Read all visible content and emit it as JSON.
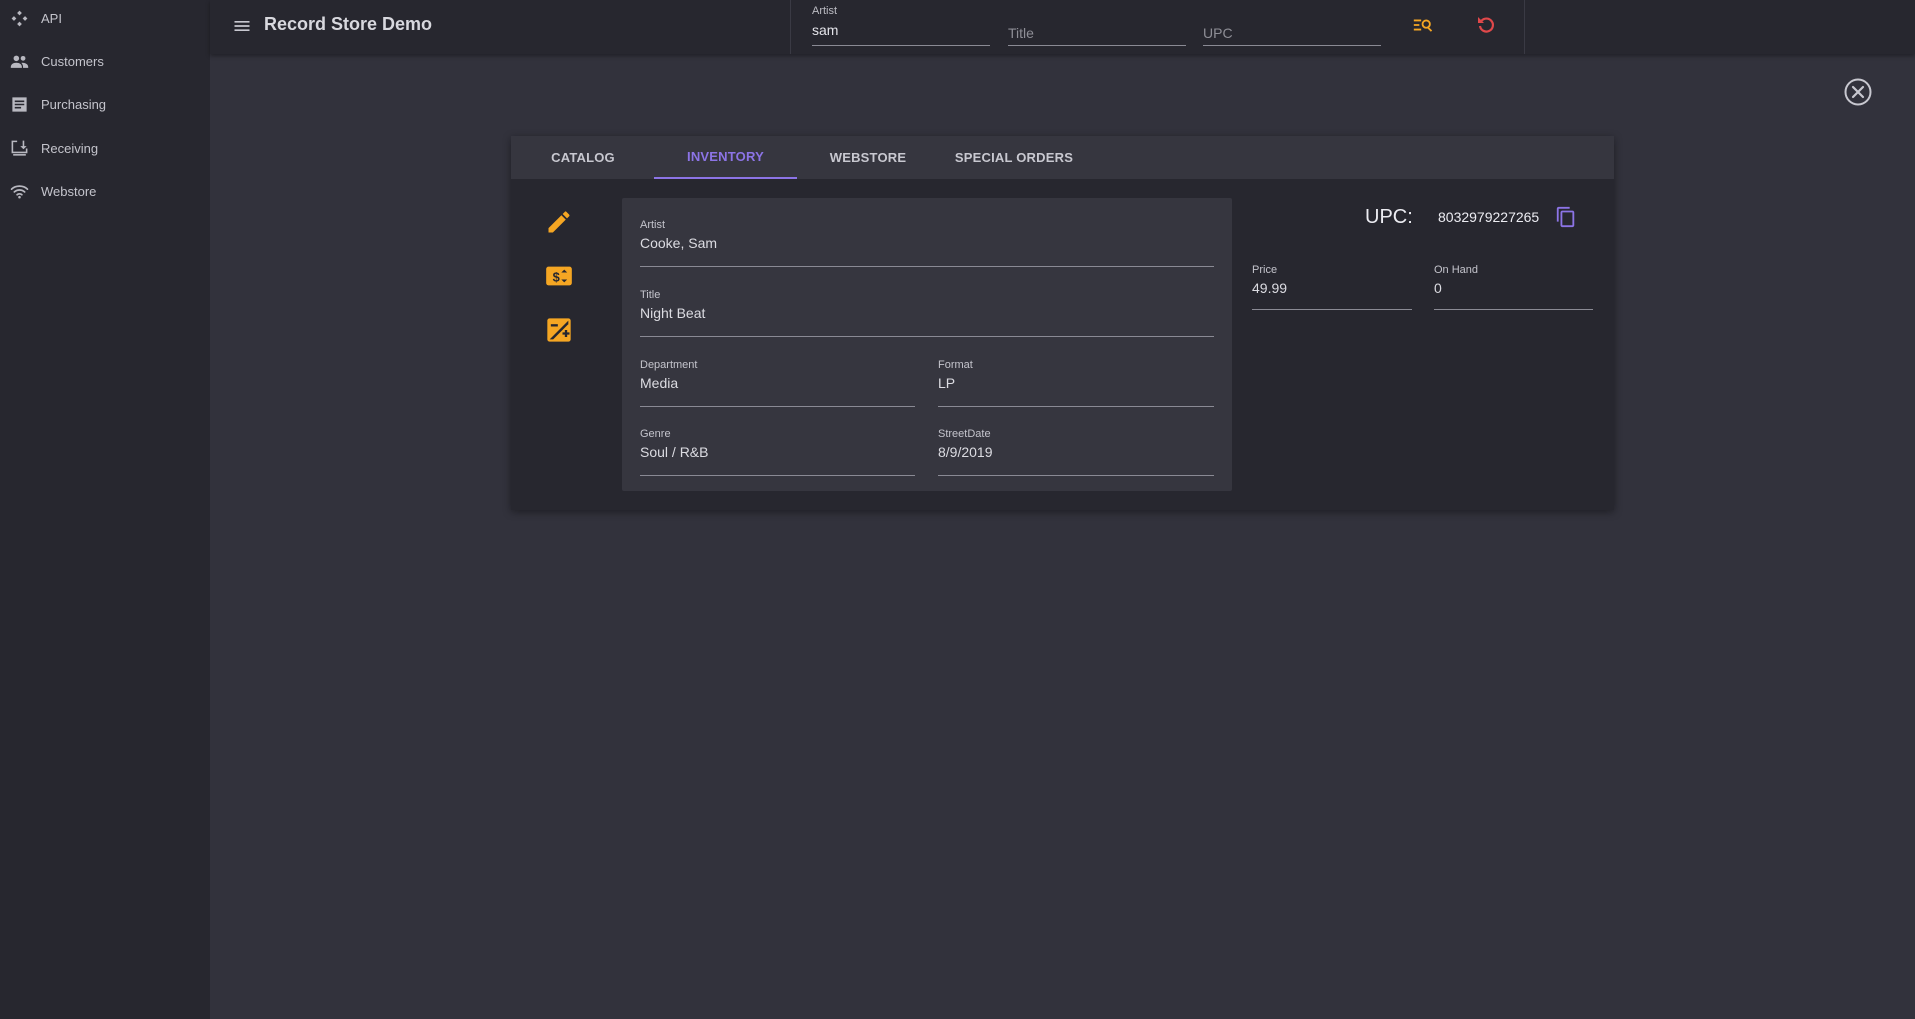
{
  "sidebar": {
    "items": [
      {
        "label": "API",
        "icon": "api-icon"
      },
      {
        "label": "Customers",
        "icon": "customers-icon"
      },
      {
        "label": "Purchasing",
        "icon": "purchasing-icon"
      },
      {
        "label": "Receiving",
        "icon": "receiving-icon"
      },
      {
        "label": "Webstore",
        "icon": "wifi-icon"
      }
    ]
  },
  "header": {
    "title": "Record Store Demo",
    "search": {
      "artist_label": "Artist",
      "artist_value": "sam",
      "title_placeholder": "Title",
      "upc_placeholder": "UPC"
    }
  },
  "tabs": [
    {
      "label": "CATALOG",
      "active": false
    },
    {
      "label": "INVENTORY",
      "active": true
    },
    {
      "label": "WEBSTORE",
      "active": false
    },
    {
      "label": "SPECIAL ORDERS",
      "active": false
    }
  ],
  "form": {
    "artist": {
      "label": "Artist",
      "value": "Cooke, Sam"
    },
    "title": {
      "label": "Title",
      "value": "Night Beat"
    },
    "department": {
      "label": "Department",
      "value": "Media"
    },
    "format": {
      "label": "Format",
      "value": "LP"
    },
    "genre": {
      "label": "Genre",
      "value": "Soul / R&B"
    },
    "street_date": {
      "label": "StreetDate",
      "value": "8/9/2019"
    }
  },
  "inventory": {
    "upc_label": "UPC:",
    "upc_value": "8032979227265",
    "price": {
      "label": "Price",
      "value": "49.99"
    },
    "on_hand": {
      "label": "On Hand",
      "value": "0"
    }
  },
  "colors": {
    "accent": "#8c74e6",
    "action": "#f5a623",
    "reset": "#e0484a"
  }
}
